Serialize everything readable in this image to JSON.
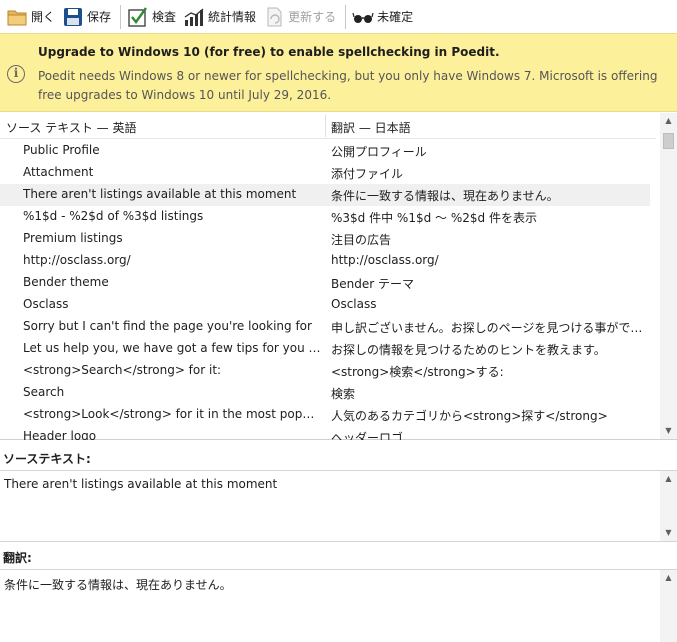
{
  "toolbar": {
    "open_label": "開く",
    "save_label": "保存",
    "validate_label": "検査",
    "stats_label": "統計情報",
    "update_label": "更新する",
    "fuzzy_label": "未確定"
  },
  "banner": {
    "title": "Upgrade to Windows 10 (for free) to enable spellchecking in Poedit.",
    "message": "Poedit needs Windows 8 or newer for spellchecking, but you only have Windows 7. Microsoft is offering free upgrades to Windows 10 until July 29, 2016."
  },
  "list": {
    "source_header": "ソース テキスト — 英語",
    "translation_header": "翻訳 — 日本語",
    "rows": [
      {
        "source": "Public Profile",
        "translation": "公開プロフィール"
      },
      {
        "source": "Attachment",
        "translation": "添付ファイル"
      },
      {
        "source": "There aren't listings available at this moment",
        "translation": "条件に一致する情報は、現在ありません。"
      },
      {
        "source": "%1$d - %2$d of %3$d listings",
        "translation": "%3$d 件中 %1$d ～ %2$d 件を表示"
      },
      {
        "source": "Premium listings",
        "translation": "注目の広告"
      },
      {
        "source": "http://osclass.org/",
        "translation": "http://osclass.org/"
      },
      {
        "source": "Bender theme",
        "translation": "Bender テーマ"
      },
      {
        "source": "Osclass",
        "translation": "Osclass"
      },
      {
        "source": "Sorry but I can't find the page you're looking for",
        "translation": "申し訳ございません。お探しのページを見つける事ができません"
      },
      {
        "source": "Let us help you, we have got a few tips for you to find it.",
        "translation": "お探しの情報を見つけるためのヒントを教えます。"
      },
      {
        "source": "<strong>Search</strong> for it:",
        "translation": "<strong>検索</strong>する:"
      },
      {
        "source": "Search",
        "translation": "検索"
      },
      {
        "source": "<strong>Look</strong> for it in the most popular categories.",
        "translation": "人気のあるカテゴリから<strong>探す</strong>"
      },
      {
        "source": "Header logo",
        "translation": "ヘッダーロゴ"
      }
    ]
  },
  "source_panel": {
    "label": "ソーステキスト:",
    "text": "There aren't listings available at this moment"
  },
  "translation_panel": {
    "label": "翻訳:",
    "text": "条件に一致する情報は、現在ありません。"
  }
}
